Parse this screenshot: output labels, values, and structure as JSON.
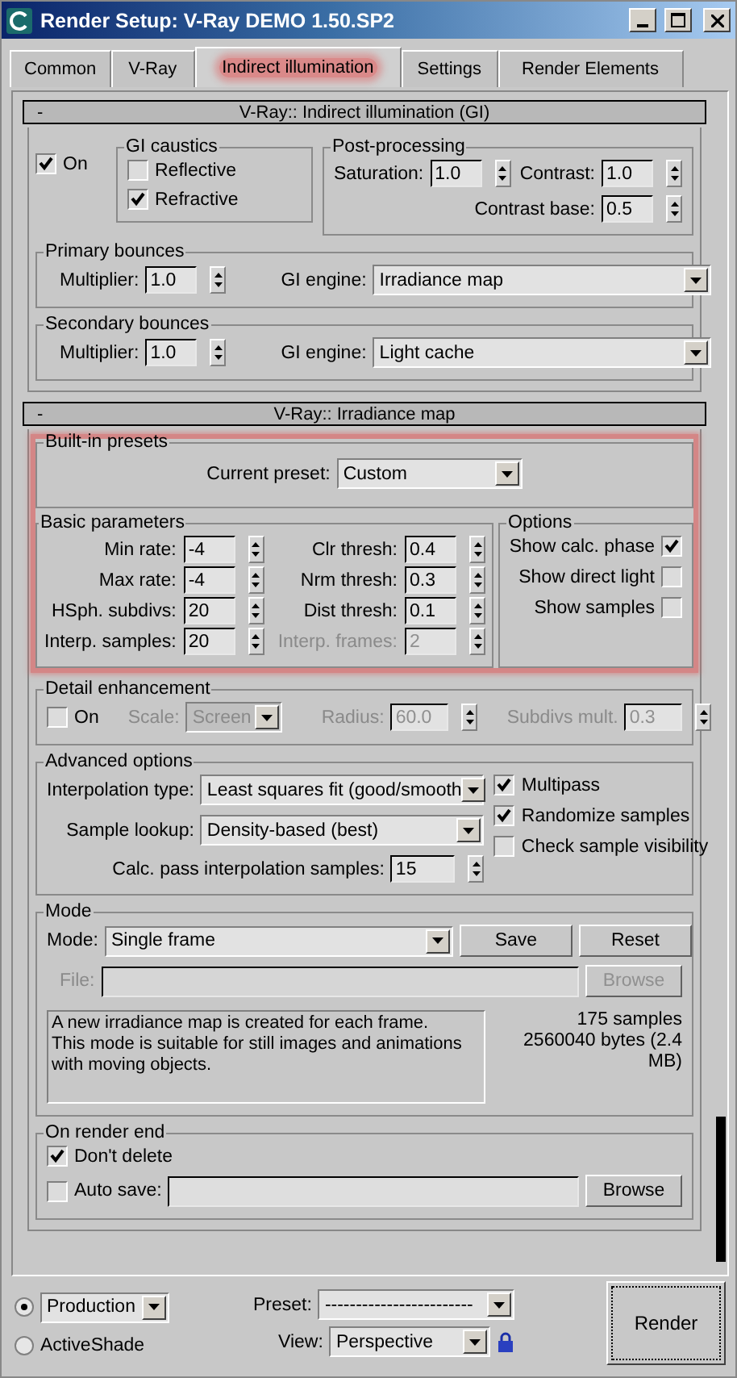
{
  "window": {
    "title": "Render Setup: V-Ray DEMO 1.50.SP2"
  },
  "tabs": [
    {
      "label": "Common",
      "selected": false
    },
    {
      "label": "V-Ray",
      "selected": false
    },
    {
      "label": "Indirect illumination",
      "selected": true
    },
    {
      "label": "Settings",
      "selected": false
    },
    {
      "label": "Render Elements",
      "selected": false
    }
  ],
  "gi_rollout": {
    "collapse": "-",
    "title": "V-Ray:: Indirect illumination (GI)",
    "on": {
      "label": "On",
      "checked": true
    },
    "gi_caustics": {
      "title": "GI caustics",
      "options": [
        {
          "label": "Reflective",
          "checked": false
        },
        {
          "label": "Refractive",
          "checked": true
        }
      ]
    },
    "post_processing": {
      "title": "Post-processing",
      "fields": [
        {
          "label": "Saturation:",
          "value": "1.0"
        },
        {
          "label": "Contrast:",
          "value": "1.0"
        },
        {
          "label": "Contrast base:",
          "value": "0.5"
        }
      ]
    },
    "bounces": [
      {
        "title": "Primary bounces",
        "multiplier_label": "Multiplier:",
        "multiplier": "1.0",
        "engine_label": "GI engine:",
        "engine": "Irradiance map"
      },
      {
        "title": "Secondary bounces",
        "multiplier_label": "Multiplier:",
        "multiplier": "1.0",
        "engine_label": "GI engine:",
        "engine": "Light cache"
      }
    ]
  },
  "irradiance_rollout": {
    "collapse": "-",
    "title": "V-Ray:: Irradiance map",
    "built_in_presets": {
      "title": "Built-in presets",
      "label": "Current preset:",
      "value": "Custom"
    },
    "basic_parameters": {
      "title": "Basic parameters",
      "fields": [
        {
          "label": "Min rate:",
          "value": "-4",
          "disabled": false
        },
        {
          "label": "Clr thresh:",
          "value": "0.4",
          "disabled": false
        },
        {
          "label": "Max rate:",
          "value": "-4",
          "disabled": false
        },
        {
          "label": "Nrm thresh:",
          "value": "0.3",
          "disabled": false
        },
        {
          "label": "HSph. subdivs:",
          "value": "20",
          "disabled": false
        },
        {
          "label": "Dist thresh:",
          "value": "0.1",
          "disabled": false
        },
        {
          "label": "Interp. samples:",
          "value": "20",
          "disabled": false
        },
        {
          "label": "Interp. frames:",
          "value": "2",
          "disabled": true
        }
      ]
    },
    "options": {
      "title": "Options",
      "items": [
        {
          "label": "Show calc. phase",
          "checked": true
        },
        {
          "label": "Show direct light",
          "checked": false
        },
        {
          "label": "Show samples",
          "checked": false
        }
      ]
    },
    "detail_enhancement": {
      "title": "Detail enhancement",
      "on": {
        "label": "On",
        "checked": false
      },
      "disabled": true,
      "scale_label": "Scale:",
      "scale": "Screen",
      "radius_label": "Radius:",
      "radius": "60.0",
      "subdivs_label": "Subdivs mult.",
      "subdivs": "0.3"
    },
    "advanced_options": {
      "title": "Advanced options",
      "interpolation_label": "Interpolation type:",
      "interpolation": "Least squares fit (good/smooth",
      "lookup_label": "Sample lookup:",
      "lookup": "Density-based (best)",
      "calc_label": "Calc. pass interpolation samples:",
      "calc_value": "15",
      "checks": [
        {
          "label": "Multipass",
          "checked": true
        },
        {
          "label": "Randomize samples",
          "checked": true
        },
        {
          "label": "Check sample visibility",
          "checked": false
        }
      ]
    },
    "mode": {
      "title": "Mode",
      "mode_label": "Mode:",
      "mode": "Single frame",
      "buttons": [
        "Save",
        "Reset"
      ],
      "file_label": "File:",
      "file_disabled": true,
      "browse": "Browse",
      "description": "A new irradiance map is created for each frame.\nThis mode is suitable for still images and animations with moving objects.",
      "samples": "175 samples",
      "bytes": "2560040 bytes (2.4 MB)"
    },
    "on_render_end": {
      "title": "On render end",
      "dont_delete": {
        "label": "Don't delete",
        "checked": true
      },
      "auto_save": {
        "label": "Auto save:",
        "checked": false
      },
      "browse": "Browse"
    }
  },
  "bottom": {
    "targets": [
      {
        "kind": "dropdown",
        "value": "Production",
        "selected": true
      },
      {
        "kind": "label",
        "label": "ActiveShade",
        "selected": false
      }
    ],
    "preset_label": "Preset:",
    "preset": "------------------------",
    "view_label": "View:",
    "view": "Perspective",
    "render": "Render"
  }
}
